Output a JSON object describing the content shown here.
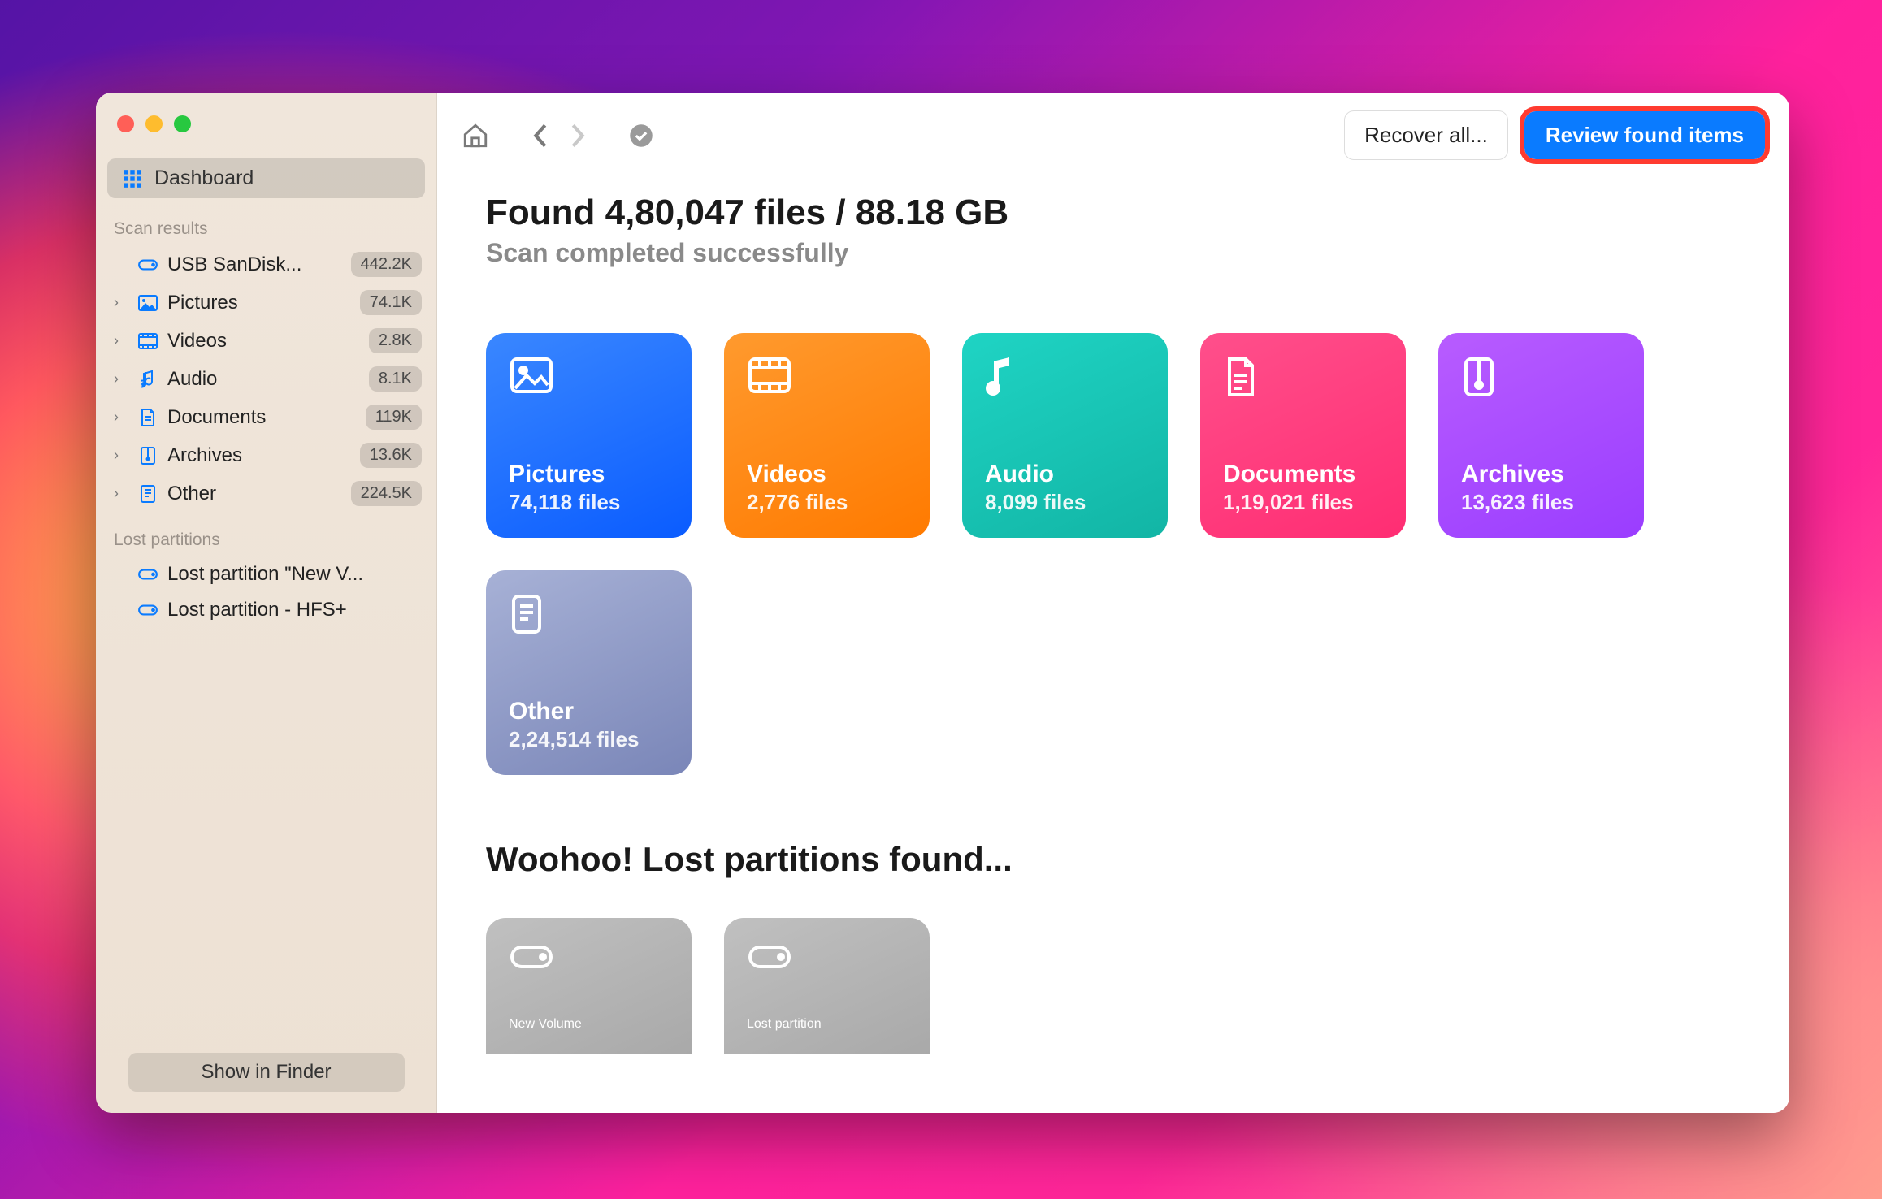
{
  "sidebar": {
    "dashboard_label": "Dashboard",
    "section_scan": "Scan results",
    "section_lost": "Lost partitions",
    "items": [
      {
        "label": "USB  SanDisk...",
        "badge": "442.2K"
      },
      {
        "label": "Pictures",
        "badge": "74.1K"
      },
      {
        "label": "Videos",
        "badge": "2.8K"
      },
      {
        "label": "Audio",
        "badge": "8.1K"
      },
      {
        "label": "Documents",
        "badge": "119K"
      },
      {
        "label": "Archives",
        "badge": "13.6K"
      },
      {
        "label": "Other",
        "badge": "224.5K"
      }
    ],
    "lost": [
      {
        "label": "Lost partition \"New V..."
      },
      {
        "label": "Lost partition - HFS+"
      }
    ],
    "footer_button": "Show in Finder"
  },
  "toolbar": {
    "recover_label": "Recover all...",
    "review_label": "Review found items"
  },
  "main": {
    "headline": "Found 4,80,047 files / 88.18 GB",
    "subhead": "Scan completed successfully",
    "cards": [
      {
        "title": "Pictures",
        "sub": "74,118 files"
      },
      {
        "title": "Videos",
        "sub": "2,776 files"
      },
      {
        "title": "Audio",
        "sub": "8,099 files"
      },
      {
        "title": "Documents",
        "sub": "1,19,021 files"
      },
      {
        "title": "Archives",
        "sub": "13,623 files"
      },
      {
        "title": "Other",
        "sub": "2,24,514 files"
      }
    ],
    "lost_title": "Woohoo! Lost partitions found...",
    "lost_cards": [
      {
        "title": "New Volume"
      },
      {
        "title": "Lost partition"
      }
    ]
  }
}
